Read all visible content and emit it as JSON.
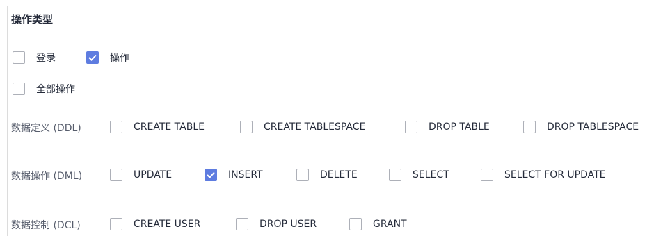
{
  "section_title": "操作类型",
  "top_options": [
    {
      "label": "登录",
      "checked": false
    },
    {
      "label": "操作",
      "checked": true
    },
    {
      "label": "全部操作",
      "checked": false
    }
  ],
  "groups": [
    {
      "label": "数据定义 (DDL)",
      "options": [
        {
          "label": "CREATE TABLE",
          "checked": false
        },
        {
          "label": "CREATE TABLESPACE",
          "checked": false
        },
        {
          "label": "DROP TABLE",
          "checked": false
        },
        {
          "label": "DROP TABLESPACE",
          "checked": false
        }
      ]
    },
    {
      "label": "数据操作 (DML)",
      "options": [
        {
          "label": "UPDATE",
          "checked": false
        },
        {
          "label": "INSERT",
          "checked": true
        },
        {
          "label": "DELETE",
          "checked": false
        },
        {
          "label": "SELECT",
          "checked": false
        },
        {
          "label": "SELECT FOR UPDATE",
          "checked": false
        }
      ]
    },
    {
      "label": "数据控制 (DCL)",
      "options": [
        {
          "label": "CREATE USER",
          "checked": false
        },
        {
          "label": "DROP USER",
          "checked": false
        },
        {
          "label": "GRANT",
          "checked": false
        }
      ]
    }
  ],
  "colors": {
    "accent": "#5e7ce0",
    "border": "#adb0b8"
  }
}
